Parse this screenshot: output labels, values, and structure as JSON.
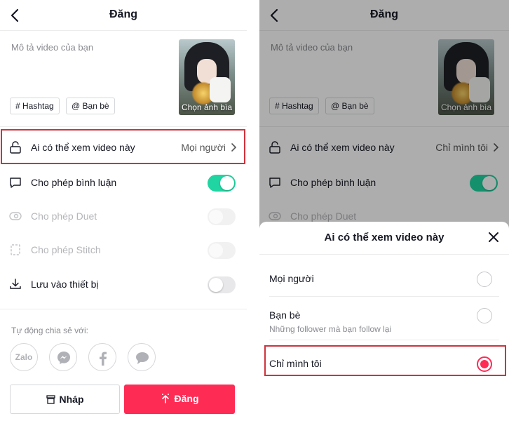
{
  "left": {
    "title": "Đăng",
    "description_placeholder": "Mô tả video của bạn",
    "hashtag_button": "# Hashtag",
    "friends_button": "@ Bạn bè",
    "cover_label": "Chọn ảnh bìa",
    "settings": [
      {
        "label": "Ai có thể xem video này",
        "value": "Mọi người",
        "icon": "lock-icon"
      },
      {
        "label": "Cho phép bình luận",
        "icon": "comment-icon",
        "toggle": true
      },
      {
        "label": "Cho phép Duet",
        "icon": "duet-icon",
        "toggle": false,
        "disabled": true
      },
      {
        "label": "Cho phép Stitch",
        "icon": "stitch-icon",
        "toggle": false,
        "disabled": true
      },
      {
        "label": "Lưu vào thiết bị",
        "icon": "download-icon",
        "toggle": false
      }
    ],
    "share_label": "Tự động chia sẻ với:",
    "share_targets": [
      "Zalo",
      "messenger-icon",
      "facebook-icon",
      "sms-icon"
    ],
    "zalo_text": "Zalo",
    "draft_button": "Nháp",
    "post_button": "Đăng"
  },
  "right": {
    "title": "Đăng",
    "description_placeholder": "Mô tả video của bạn",
    "hashtag_button": "# Hashtag",
    "friends_button": "@ Bạn bè",
    "cover_label": "Chọn ảnh bìa",
    "privacy_label": "Ai có thể xem video này",
    "privacy_value": "Chỉ mình tôi",
    "comment_label": "Cho phép bình luận",
    "duet_label": "Cho phép Duet",
    "sheet": {
      "title": "Ai có thể xem video này",
      "options": [
        {
          "label": "Mọi người",
          "selected": false
        },
        {
          "label": "Bạn bè",
          "sublabel": "Những follower mà bạn follow lại",
          "selected": false
        },
        {
          "label": "Chỉ mình tôi",
          "selected": true
        }
      ]
    }
  },
  "colors": {
    "accent": "#fe2c55",
    "toggle_on": "#20d5a1",
    "highlight": "#d0323c"
  }
}
